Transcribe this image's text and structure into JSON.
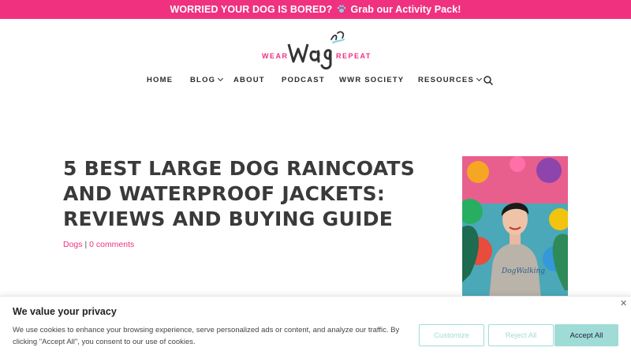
{
  "announcement": {
    "text_before": "WORRIED YOUR DOG IS BORED?",
    "icon": "paw-icon",
    "text_after": "Grab our Activity Pack!"
  },
  "logo": {
    "left": "WEAR",
    "middle": "wag",
    "right": "REPEAT"
  },
  "nav": {
    "items": [
      {
        "label": "HOME"
      },
      {
        "label": "BLOG"
      },
      {
        "label": "ABOUT"
      },
      {
        "label": "PODCAST"
      },
      {
        "label": "WWR SOCIETY"
      },
      {
        "label": "RESOURCES"
      }
    ],
    "search_icon": "search-icon"
  },
  "article": {
    "title": "5 BEST LARGE DOG RAINCOATS AND WATERPROOF JACKETS: REVIEWS AND BUYING GUIDE",
    "category": "Dogs",
    "separator": "|",
    "comments": "0 comments"
  },
  "sidebar": {
    "photo_shirt_text": "DogWalking"
  },
  "cookie": {
    "title": "We value your privacy",
    "body": "We use cookies to enhance your browsing experience, serve personalized ads or content, and analyze our traffic. By clicking \"Accept All\", you consent to our use of cookies.",
    "customize": "Customize",
    "reject": "Reject All",
    "accept": "Accept All",
    "close_icon": "close-icon"
  },
  "colors": {
    "brand_pink": "#f0317f",
    "accent_teal": "#9fdcd6"
  }
}
